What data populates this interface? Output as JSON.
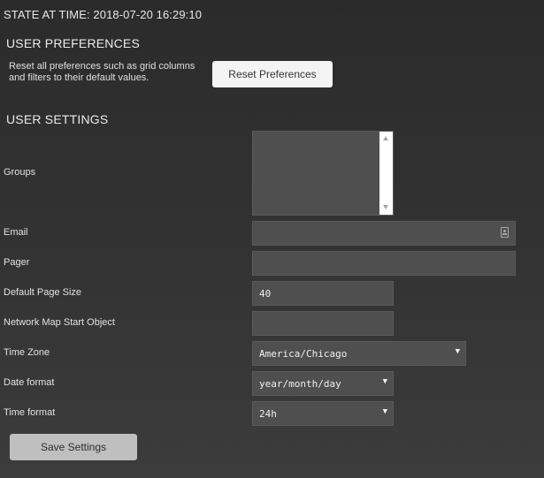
{
  "state_title": "STATE AT TIME: 2018-07-20 16:29:10",
  "user_preferences": {
    "heading": "USER PREFERENCES",
    "description": "Reset all preferences such as grid columns and filters to their default values.",
    "reset_button": "Reset Preferences"
  },
  "user_settings": {
    "heading": "USER SETTINGS",
    "groups": {
      "label": "Groups"
    },
    "email": {
      "label": "Email",
      "value": ""
    },
    "pager": {
      "label": "Pager",
      "value": ""
    },
    "default_page_size": {
      "label": "Default Page Size",
      "value": "40"
    },
    "network_map_start_object": {
      "label": "Network Map Start Object",
      "value": ""
    },
    "time_zone": {
      "label": "Time Zone",
      "value": "America/Chicago"
    },
    "date_format": {
      "label": "Date format",
      "value": "year/month/day"
    },
    "time_format": {
      "label": "Time format",
      "value": "24h"
    },
    "save_button": "Save Settings"
  },
  "colors": {
    "background": "#333333",
    "field_background": "#4f4f4f",
    "reset_button_background": "#f4f4f4",
    "save_button_background": "#bfbfbf"
  },
  "icons": [
    "scroll-up-arrow-icon",
    "scroll-down-arrow-icon",
    "contact-card-icon",
    "caret-down-icon"
  ]
}
